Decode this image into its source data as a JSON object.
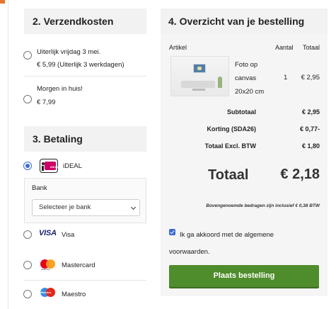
{
  "shipping": {
    "title": "2. Verzendkosten",
    "options": [
      {
        "line1": "Uiterlijk vrijdag 3 mei.",
        "line2": "€ 5,99 (Uiterlijk 3 werkdagen)"
      },
      {
        "line1": "Morgen in huis!",
        "line2": "€ 7,99"
      }
    ]
  },
  "payment": {
    "title": "3. Betaling",
    "methods": [
      {
        "label": "iDEAL",
        "selected": true,
        "icon": "ideal-logo"
      },
      {
        "label": "Visa",
        "selected": false,
        "icon": "visa-logo"
      },
      {
        "label": "Mastercard",
        "selected": false,
        "icon": "mastercard-logo"
      },
      {
        "label": "Maestro",
        "selected": false,
        "icon": "maestro-logo"
      }
    ],
    "bank": {
      "label": "Bank",
      "placeholder": "Selecteer je bank"
    },
    "logo_text": {
      "ideal": "iDEAL",
      "visa": "VISA",
      "mastercard": "mastercard",
      "maestro": "Maestro"
    }
  },
  "overview": {
    "title": "4. Overzicht van je bestelling",
    "columns": {
      "article": "Artikel",
      "qty": "Aantal",
      "total": "Totaal"
    },
    "item": {
      "name": "Foto op canvas 20x20 cm",
      "qty": "1",
      "total": "€ 2,95"
    },
    "summary": [
      {
        "label": "Subtotaal",
        "value": "€ 2,95"
      },
      {
        "label": "Korting (SDA26)",
        "value": "€ 0,77-"
      },
      {
        "label": "Totaal Excl. BTW",
        "value": "€ 1,80"
      }
    ],
    "grand_total": {
      "label": "Totaal",
      "value": "€ 2,18"
    },
    "footnote": "Bovengenoemde bedragen zijn inclusief € 0,38 BTW",
    "agree": {
      "text": "Ik ga akkoord met de algemene voorwaarden.",
      "checked": true
    },
    "order_button": "Plaats bestelling"
  },
  "colors": {
    "accent": "#3d6ad6",
    "button": "#4f8c2b",
    "panel": "#f5f5f5"
  }
}
